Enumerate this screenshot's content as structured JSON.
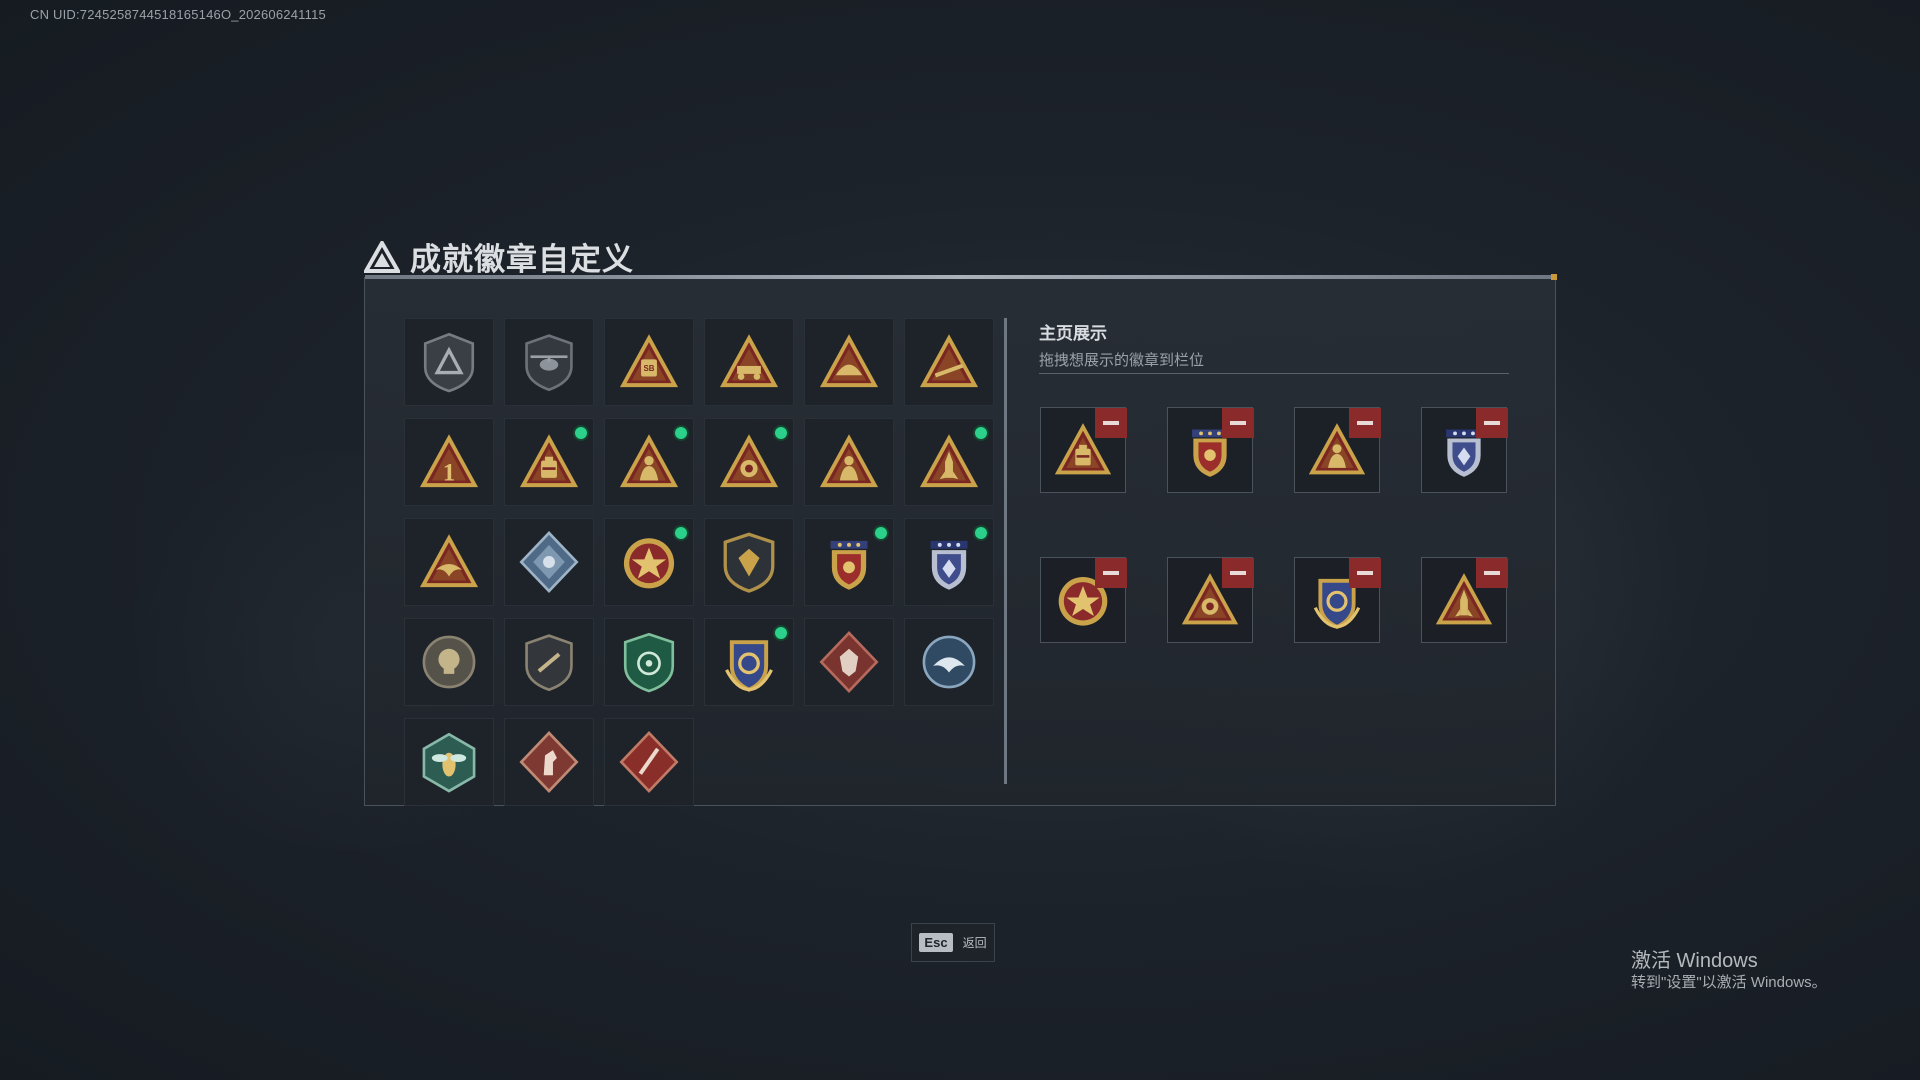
{
  "uid_text": "CN UID:7245258744518165146O_202606241115",
  "title": "成就徽章自定义",
  "grid": {
    "badges": [
      {
        "name": "shield-triangle-badge-icon",
        "new": false
      },
      {
        "name": "helicopter-badge-icon",
        "new": false
      },
      {
        "name": "sb-triangle-badge-icon",
        "new": false
      },
      {
        "name": "vehicle-triangle-badge-icon",
        "new": false
      },
      {
        "name": "hat-triangle-badge-icon",
        "new": false
      },
      {
        "name": "rifle-triangle-badge-icon",
        "new": false
      },
      {
        "name": "number-one-badge-icon",
        "new": false
      },
      {
        "name": "bag-triangle-badge-icon",
        "new": true
      },
      {
        "name": "soldier-triangle-badge-icon",
        "new": true
      },
      {
        "name": "lion-triangle-badge-icon",
        "new": true
      },
      {
        "name": "squad-triangle-badge-icon",
        "new": false
      },
      {
        "name": "rocket-triangle-badge-icon",
        "new": true
      },
      {
        "name": "eagle-triangle-badge-icon",
        "new": false
      },
      {
        "name": "diamond-blue-badge-icon",
        "new": false
      },
      {
        "name": "star-medal-badge-icon",
        "new": true
      },
      {
        "name": "dark-shield-badge-icon",
        "new": false
      },
      {
        "name": "red-crest-badge-icon",
        "new": true
      },
      {
        "name": "blue-crest-badge-icon",
        "new": true
      },
      {
        "name": "round-skull-badge-icon",
        "new": false
      },
      {
        "name": "knife-shield-badge-icon",
        "new": false
      },
      {
        "name": "green-target-badge-icon",
        "new": false
      },
      {
        "name": "golden-wreath-badge-icon",
        "new": true
      },
      {
        "name": "wolf-diamond-badge-icon",
        "new": false
      },
      {
        "name": "eagle-round-badge-icon",
        "new": false
      },
      {
        "name": "wasp-hex-badge-icon",
        "new": false
      },
      {
        "name": "horse-diamond-badge-icon",
        "new": false
      },
      {
        "name": "sword-diamond-badge-icon",
        "new": false
      }
    ]
  },
  "showcase": {
    "title": "主页展示",
    "subtitle": "拖拽想展示的徽章到栏位",
    "slots": [
      {
        "name": "bag-triangle-badge-icon"
      },
      {
        "name": "red-crest-badge-icon"
      },
      {
        "name": "soldier-triangle-badge-icon"
      },
      {
        "name": "blue-crest-badge-icon"
      },
      {
        "name": "star-medal-badge-icon"
      },
      {
        "name": "lion-triangle-badge-icon"
      },
      {
        "name": "golden-wreath-badge-icon"
      },
      {
        "name": "rocket-triangle-badge-icon"
      }
    ]
  },
  "footer": {
    "esc_key": "Esc",
    "esc_label": "返回"
  },
  "watermark": {
    "line1": "激活 Windows",
    "line2": "转到\"设置\"以激活 Windows。"
  },
  "colors": {
    "gold": "#c9a24a",
    "dark_red": "#7a2622",
    "new_dot": "#2bd08a",
    "remove_red": "#8b2a2a"
  }
}
